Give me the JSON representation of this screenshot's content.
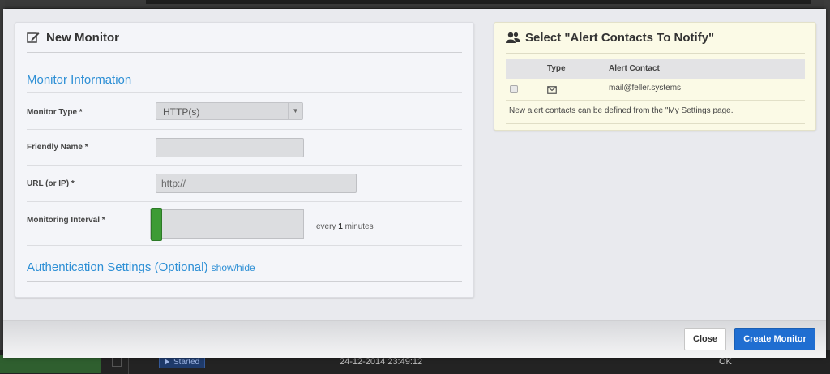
{
  "background": {
    "status_badge": "Started",
    "timestamp": "24-12-2014 23:49:12",
    "status_ok": "OK"
  },
  "monitor_form": {
    "title": "New Monitor",
    "title_icon": "edit-icon",
    "section_title": "Monitor Information",
    "fields": {
      "monitor_type": {
        "label": "Monitor Type *",
        "value": "HTTP(s)"
      },
      "friendly_name": {
        "label": "Friendly Name *",
        "value": ""
      },
      "url": {
        "label": "URL (or IP) *",
        "placeholder": "http://"
      },
      "interval": {
        "label": "Monitoring Interval *",
        "prefix": "every",
        "value": "1",
        "suffix": "minutes",
        "slider_level": 0
      }
    },
    "auth_section": {
      "title": "Authentication Settings (Optional)",
      "toggle": "show/hide"
    }
  },
  "alert_contacts": {
    "title": "Select \"Alert Contacts To Notify\"",
    "title_icon": "users-icon",
    "columns": [
      "",
      "Type",
      "Alert Contact"
    ],
    "rows": [
      {
        "checked": false,
        "type_icon": "envelope-icon",
        "contact": "mail@feller.systems"
      }
    ],
    "note": "New alert contacts can be defined from the \"My Settings page."
  },
  "footer": {
    "close_label": "Close",
    "create_label": "Create Monitor"
  },
  "colors": {
    "accent_blue": "#2d8fd5",
    "primary_button": "#1f6ed1",
    "slider_green": "#3d9b35",
    "contacts_panel_bg": "#fbfae6"
  }
}
